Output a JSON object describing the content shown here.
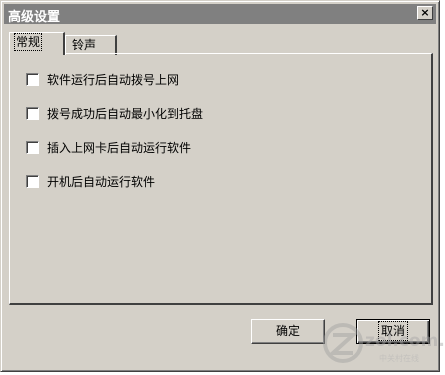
{
  "window": {
    "title": "高级设置",
    "close_label": "×"
  },
  "tabs": [
    {
      "label": "常规",
      "selected": true
    },
    {
      "label": "铃声",
      "selected": false
    }
  ],
  "options": [
    {
      "label": "软件运行后自动拨号上网",
      "checked": false
    },
    {
      "label": "拨号成功后自动最小化到托盘",
      "checked": false
    },
    {
      "label": "插入上网卡后自动运行软件",
      "checked": false
    },
    {
      "label": "开机后自动运行软件",
      "checked": false
    }
  ],
  "buttons": {
    "ok_label": "确定",
    "cancel_label": "取消"
  },
  "watermark": {
    "text": "zol.com.cn",
    "subtext": "中关村在线"
  }
}
